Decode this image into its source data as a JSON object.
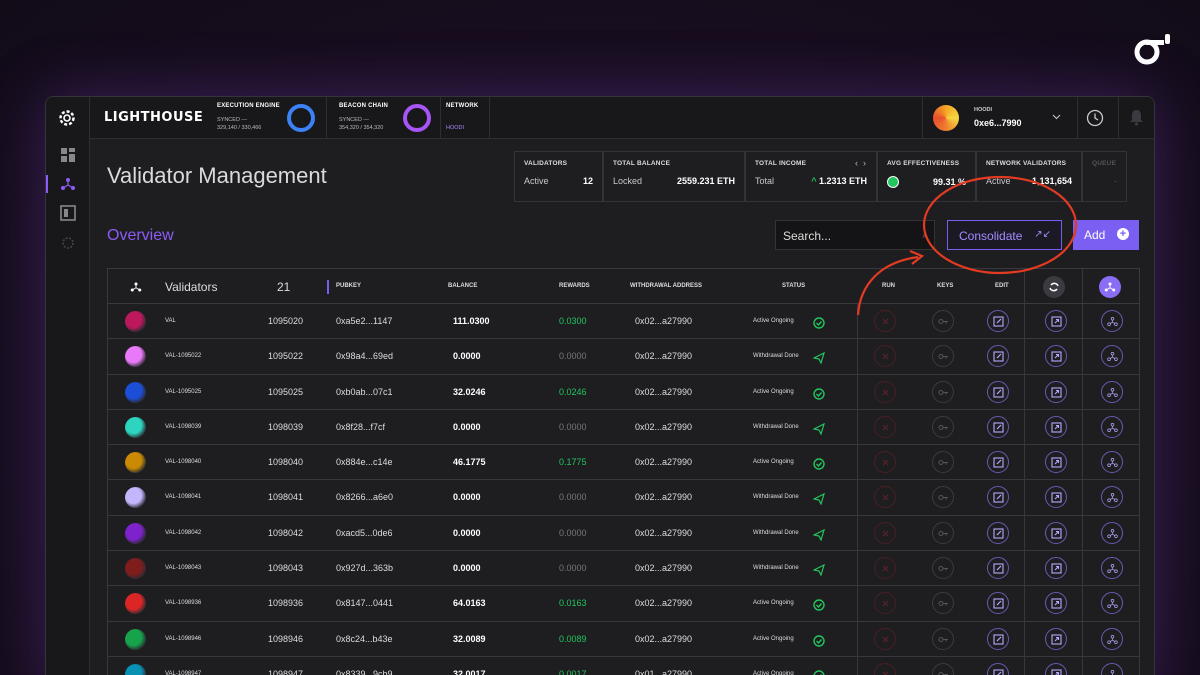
{
  "app": {
    "logo": "LIGHTHOUSE"
  },
  "chains": {
    "execution": {
      "title": "EXECUTION ENGINE",
      "status": "SYNCED —",
      "progress": "329,140 / 330,466",
      "color": "#3b82f6"
    },
    "beacon": {
      "title": "BEACON CHAIN",
      "status": "SYNCED —",
      "progress": "354,320 / 354,320",
      "color": "#a855f7"
    },
    "network": {
      "title": "NETWORK",
      "value": "HOODI"
    }
  },
  "account": {
    "label": "HOODI",
    "address": "0xe6...7990"
  },
  "page": {
    "title": "Validator Management",
    "section": "Overview"
  },
  "stats": [
    {
      "header": "VALIDATORS",
      "label": "Active",
      "value": "12"
    },
    {
      "header": "TOTAL BALANCE",
      "label": "Locked",
      "value": "2559.231 ETH"
    },
    {
      "header": "TOTAL INCOME",
      "label": "Total",
      "value": "1.2313 ETH"
    },
    {
      "header": "AVG EFFECTIVENESS",
      "label": "",
      "value": "99.31 %"
    },
    {
      "header": "NETWORK VALIDATORS",
      "label": "Active",
      "value": "1,131,654"
    },
    {
      "header": "QUEUE",
      "label": "",
      "value": "-"
    }
  ],
  "toolbar": {
    "search_placeholder": "Search...",
    "consolidate_label": "Consolidate",
    "add_label": "Add"
  },
  "table": {
    "title": "Validators",
    "count": "21",
    "headers": {
      "pubkey": "PUBKEY",
      "balance": "BALANCE",
      "rewards": "REWARDS",
      "withdrawal": "WITHDRAWAL ADDRESS",
      "status": "STATUS",
      "run": "RUN",
      "keys": "KEYS",
      "edit": "EDIT"
    },
    "rows": [
      {
        "name": "VAL",
        "index": "1095020",
        "pubkey": "0xa5e2...1147",
        "balance": "111.0300",
        "rewards": "0.0300",
        "withdrawal": "0x02...a27990",
        "status": "Active Ongoing",
        "color": "#be185d"
      },
      {
        "name": "VAL-1095022",
        "index": "1095022",
        "pubkey": "0x98a4...69ed",
        "balance": "0.0000",
        "rewards": "0.0000",
        "withdrawal": "0x02...a27990",
        "status": "Withdrawal Done",
        "color": "#e879f9"
      },
      {
        "name": "VAL-1095025",
        "index": "1095025",
        "pubkey": "0xb0ab...07c1",
        "balance": "32.0246",
        "rewards": "0.0246",
        "withdrawal": "0x02...a27990",
        "status": "Active Ongoing",
        "color": "#1d4ed8"
      },
      {
        "name": "VAL-1098039",
        "index": "1098039",
        "pubkey": "0x8f28...f7cf",
        "balance": "0.0000",
        "rewards": "0.0000",
        "withdrawal": "0x02...a27990",
        "status": "Withdrawal Done",
        "color": "#2dd4bf"
      },
      {
        "name": "VAL-1098040",
        "index": "1098040",
        "pubkey": "0x884e...c14e",
        "balance": "46.1775",
        "rewards": "0.1775",
        "withdrawal": "0x02...a27990",
        "status": "Active Ongoing",
        "color": "#ca8a04"
      },
      {
        "name": "VAL-1098041",
        "index": "1098041",
        "pubkey": "0x8266...a6e0",
        "balance": "0.0000",
        "rewards": "0.0000",
        "withdrawal": "0x02...a27990",
        "status": "Withdrawal Done",
        "color": "#c4b5fd"
      },
      {
        "name": "VAL-1098042",
        "index": "1098042",
        "pubkey": "0xacd5...0de6",
        "balance": "0.0000",
        "rewards": "0.0000",
        "withdrawal": "0x02...a27990",
        "status": "Withdrawal Done",
        "color": "#7e22ce"
      },
      {
        "name": "VAL-1098043",
        "index": "1098043",
        "pubkey": "0x927d...363b",
        "balance": "0.0000",
        "rewards": "0.0000",
        "withdrawal": "0x02...a27990",
        "status": "Withdrawal Done",
        "color": "#7f1d1d"
      },
      {
        "name": "VAL-1098936",
        "index": "1098936",
        "pubkey": "0x8147...0441",
        "balance": "64.0163",
        "rewards": "0.0163",
        "withdrawal": "0x02...a27990",
        "status": "Active Ongoing",
        "color": "#dc2626"
      },
      {
        "name": "VAL-1098946",
        "index": "1098946",
        "pubkey": "0x8c24...b43e",
        "balance": "32.0089",
        "rewards": "0.0089",
        "withdrawal": "0x02...a27990",
        "status": "Active Ongoing",
        "color": "#16a34a"
      },
      {
        "name": "VAL-1098947",
        "index": "1098947",
        "pubkey": "0x8339...9cb9",
        "balance": "32.0017",
        "rewards": "0.0017",
        "withdrawal": "0x01...a27990",
        "status": "Active Ongoing",
        "color": "#0891b2"
      }
    ]
  }
}
